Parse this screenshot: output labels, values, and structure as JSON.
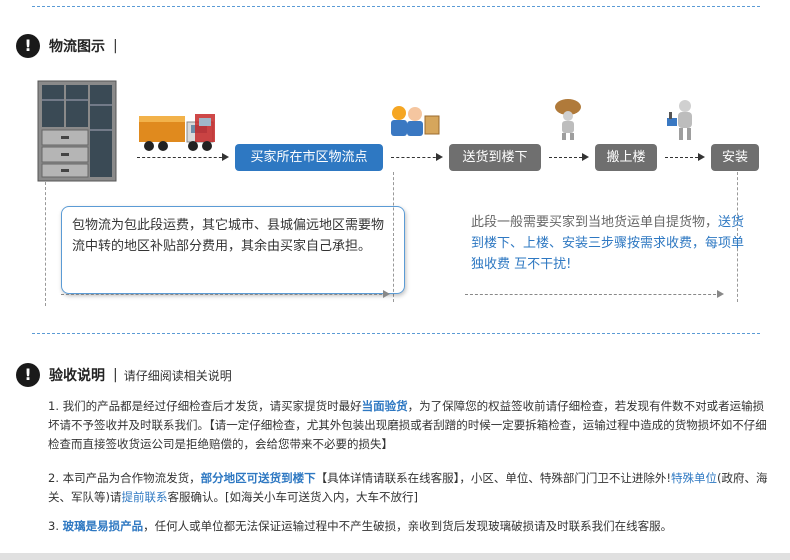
{
  "section1": {
    "title": "物流图示",
    "bar": "|"
  },
  "flow": {
    "step1": "买家所在市区物流点",
    "step2": "送货到楼下",
    "step3": "搬上楼",
    "step4": "安装",
    "left_note": "包物流为包此段运费，其它城市、县城偏远地区需要物流中转的地区补贴部分费用，其余由买家自己承担。",
    "right_note_1": "此段一般需要买家到当地货运单自提货物，",
    "right_note_2": "送货到楼下、上楼、安装三步骤按需求收费，每项单独收费 互不干扰!"
  },
  "section2": {
    "title": "验收说明",
    "bar": "|",
    "subtitle": "请仔细阅读相关说明"
  },
  "acceptance": {
    "p1_a": "1. 我们的产品都是经过仔细检查后才发货，请买家提货时最好",
    "p1_hl": "当面验货",
    "p1_b": "，为了保障您的权益签收前请仔细检查，若发现有件数不对或者运输损坏请不予签收并及时联系我们。【请一定仔细检查，尤其外包装出现磨损或者刮蹭的时候一定要拆箱检查，运输过程中造成的货物损坏如不仔细检查而直接签收货运公司是拒绝赔偿的，会给您带来不必要的损失】",
    "p2_a": "2. 本司产品为合作物流发货，",
    "p2_hl": "部分地区可送货到楼下",
    "p2_b": "【具体详情请联系在线客服】，小区、单位、特殊部门门卫不让进除外!",
    "p2_hl2": "特殊单位",
    "p2_c": "(政府、海关、军队等)请",
    "p2_hl3": "提前联系",
    "p2_d": "客服确认。[如海关小车可送货入内，大车不放行]",
    "p3_a": "3. ",
    "p3_hl": "玻璃是易损产品",
    "p3_b": "，任何人或单位都无法保证运输过程中不产生破损，亲收到货后发现玻璃破损请及时联系我们在线客服。"
  },
  "colors": {
    "accent": "#2e78c2",
    "step_gray": "#6f6f6f",
    "dash": "#5b9bd5"
  }
}
